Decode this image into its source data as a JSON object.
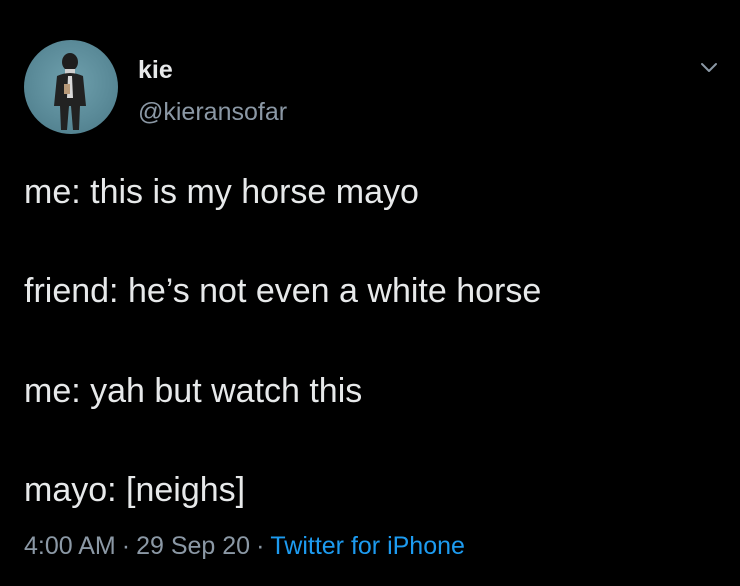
{
  "author": {
    "display_name": "kie",
    "handle": "@kieransofar",
    "avatar_icon": "person-avatar"
  },
  "tweet": {
    "lines": [
      "me: this is my horse mayo",
      "friend: he’s not even a white horse",
      "me: yah but watch this",
      "mayo: [neighs]"
    ],
    "time": "4:00 AM",
    "date": "29 Sep 20",
    "source": "Twitter for iPhone",
    "separator": "·"
  },
  "colors": {
    "background": "#000000",
    "text": "#e7e9ea",
    "secondary": "#8b98a5",
    "link": "#1d9bf0"
  },
  "icons": {
    "menu": "chevron-down-icon"
  }
}
